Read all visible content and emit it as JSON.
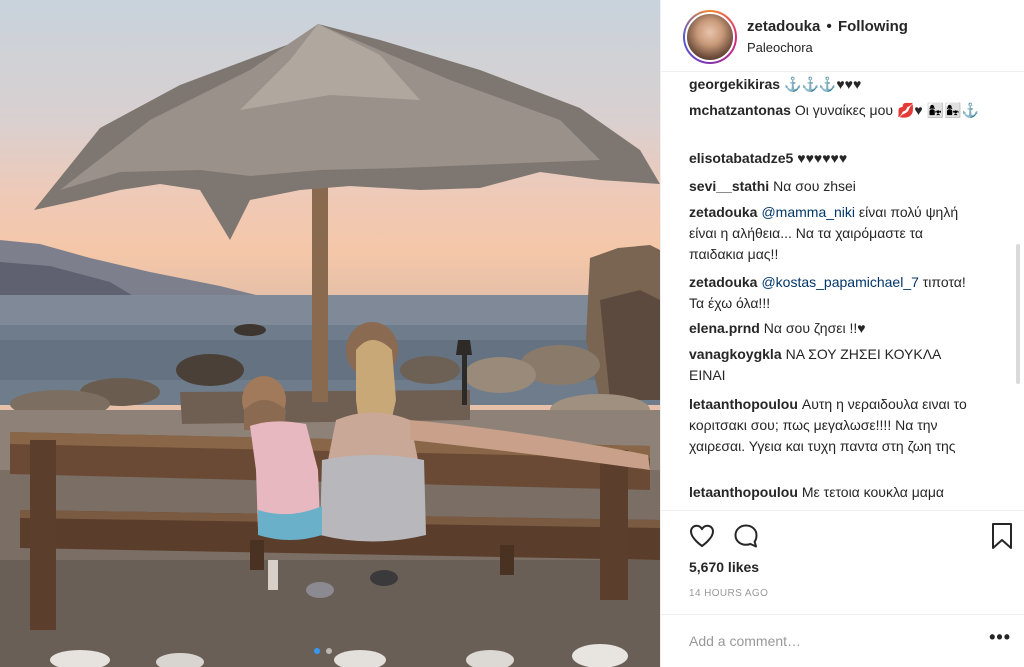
{
  "header": {
    "username": "zetadouka",
    "separator": "•",
    "follow_status": "Following",
    "location": "Paleochora"
  },
  "comments": [
    {
      "user": "georgekikiras",
      "text": "⚓⚓⚓♥♥♥"
    },
    {
      "user": "mchatzantonas",
      "text": "Οι γυναίκες μου 💋♥ 👩‍👧👩‍👧⚓"
    },
    {
      "user": "elisotabatadze5",
      "text": "♥♥♥♥♥♥"
    },
    {
      "user": "sevi__stathi",
      "text": "Να σου zhsei"
    },
    {
      "user": "zetadouka",
      "mention": "@mamma_niki",
      "text": " είναι πολύ ψηλή είναι η αλήθεια... Να τα χαιρόμαστε τα παιδακια μας!!"
    },
    {
      "user": "zetadouka",
      "mention": "@kostas_papamichael_7",
      "text": " τιποτα! Τα έχω όλα!!!"
    },
    {
      "user": "elena.prnd",
      "text": "Να σου ζησει !!♥"
    },
    {
      "user": "vanagkoygkla",
      "text": "ΝΑ ΣΟΥ ΖΗΣΕΙ ΚΟΥΚΛΑ ΕΙΝΑΙ"
    },
    {
      "user": "letaanthopoulou",
      "text": "Αυτη η νεραιδουλα ειναι το κοριτσακι σου; πως μεγαλωσε!!!! Να την χαιρεσαι. Υγεια και τυχη παντα στη ζωη της"
    },
    {
      "user": "letaanthopoulou",
      "text": "Με τετοια κουκλα μαμα"
    }
  ],
  "actions": {
    "likes": "5,670 likes",
    "timestamp": "14 HOURS AGO"
  },
  "comment_box": {
    "placeholder": "Add a comment…",
    "more": "•••"
  },
  "icons": {
    "like": "heart-icon",
    "comment": "speech-bubble-icon",
    "save": "bookmark-icon",
    "more": "ellipsis-icon"
  },
  "colors": {
    "accent": "#3897f0",
    "mention": "#003569",
    "border": "#efefef",
    "muted": "#999999"
  },
  "carousel": {
    "slides": 2,
    "active": 1
  }
}
